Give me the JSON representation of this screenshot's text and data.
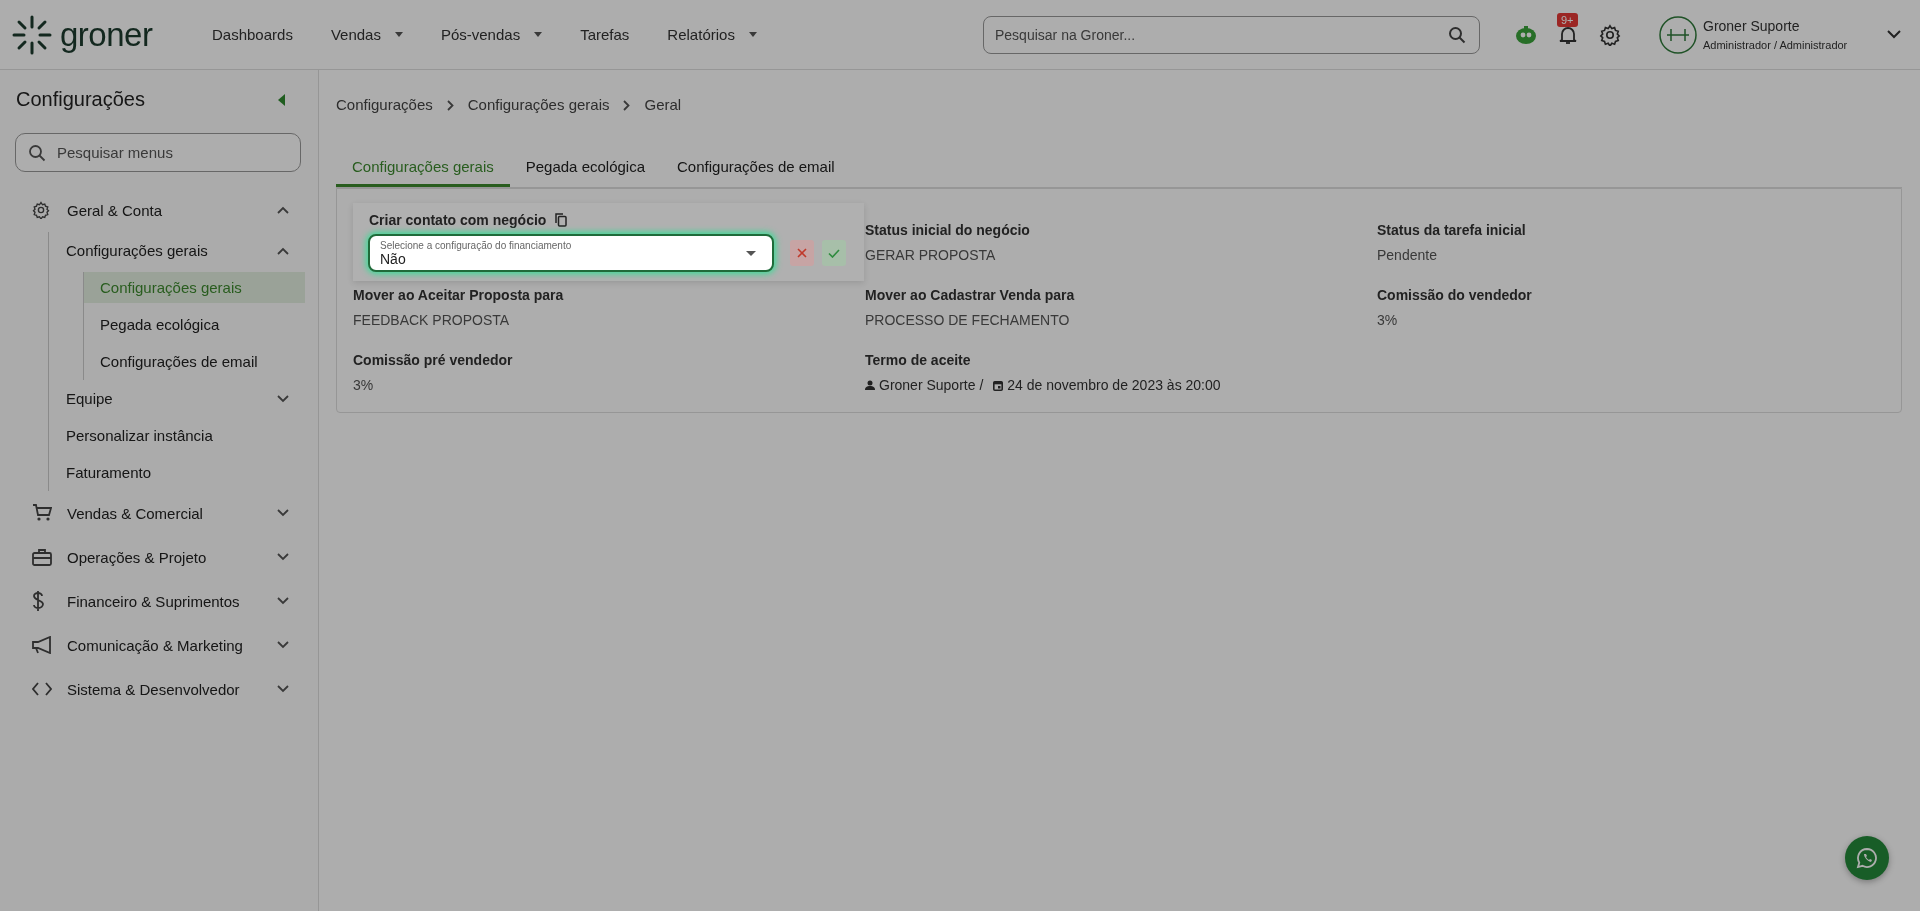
{
  "header": {
    "logo": "groner",
    "nav": [
      {
        "label": "Dashboards",
        "dropdown": false
      },
      {
        "label": "Vendas",
        "dropdown": true
      },
      {
        "label": "Pós-vendas",
        "dropdown": true
      },
      {
        "label": "Tarefas",
        "dropdown": false
      },
      {
        "label": "Relatórios",
        "dropdown": true
      }
    ],
    "search": {
      "placeholder": "Pesquisar na Groner..."
    },
    "notifications_badge": "9+",
    "user": {
      "name": "Groner Suporte",
      "role": "Administrador / Administrador"
    }
  },
  "sidebar": {
    "title": "Configurações",
    "search": {
      "placeholder": "Pesquisar menus"
    },
    "items": [
      {
        "label": "Geral & Conta",
        "kind": "gear",
        "expanded": true,
        "children": [
          {
            "label": "Configurações gerais",
            "expanded": true,
            "children": [
              {
                "label": "Configurações gerais",
                "selected": true
              },
              {
                "label": "Pegada ecológica",
                "selected": false
              },
              {
                "label": "Configurações de email",
                "selected": false
              }
            ]
          },
          {
            "label": "Equipe",
            "expanded": false
          },
          {
            "label": "Personalizar instância"
          },
          {
            "label": "Faturamento"
          }
        ]
      },
      {
        "label": "Vendas & Comercial",
        "kind": "cart",
        "expanded": false
      },
      {
        "label": "Operações & Projeto",
        "kind": "briefcase",
        "expanded": false
      },
      {
        "label": "Financeiro & Suprimentos",
        "kind": "dollar",
        "expanded": false
      },
      {
        "label": "Comunicação & Marketing",
        "kind": "megaphone",
        "expanded": false
      },
      {
        "label": "Sistema & Desenvolvedor",
        "kind": "code",
        "expanded": false
      }
    ]
  },
  "breadcrumb": [
    "Configurações",
    "Configurações gerais",
    "Geral"
  ],
  "tabs": [
    {
      "label": "Configurações gerais",
      "selected": true
    },
    {
      "label": "Pegada ecológica",
      "selected": false
    },
    {
      "label": "Configurações de email",
      "selected": false
    }
  ],
  "fields": [
    {
      "kind": "text",
      "label": "Status inicial do negócio",
      "value": "GERAR PROPOSTA"
    },
    {
      "kind": "text",
      "label": "Status da tarefa inicial",
      "value": "Pendente"
    },
    {
      "kind": "text",
      "label": "Mover ao Aceitar Proposta para",
      "value": "FEEDBACK PROPOSTA"
    },
    {
      "kind": "text",
      "label": "Mover ao Cadastrar Venda para",
      "value": "PROCESSO DE FECHAMENTO"
    },
    {
      "kind": "text",
      "label": "Comissão do vendedor",
      "value": "3%"
    },
    {
      "kind": "text",
      "label": "Comissão pré vendedor",
      "value": "3%"
    },
    {
      "kind": "signature",
      "label": "Termo de aceite",
      "user": "Groner Suporte /",
      "date": "24 de novembro de 2023 às 20:00"
    }
  ],
  "editor": {
    "label": "Criar contato com negócio",
    "select_label": "Selecione a configuração do financiamento",
    "value": "Não"
  }
}
